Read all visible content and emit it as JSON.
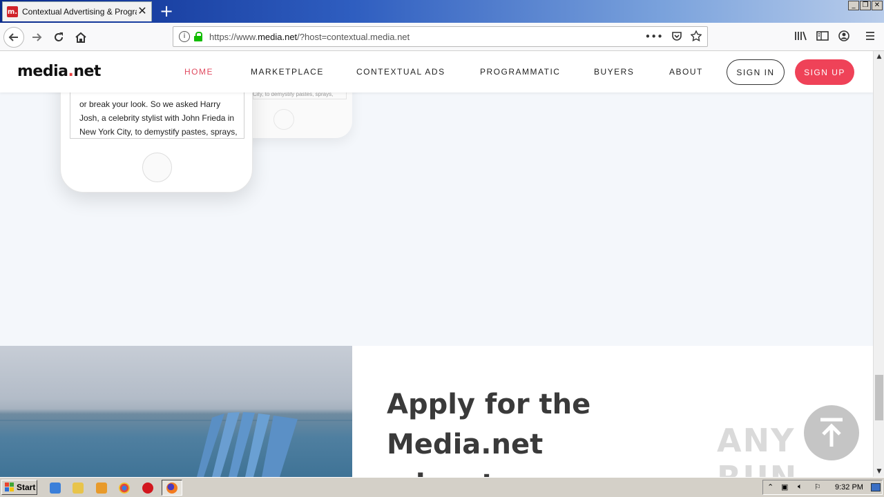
{
  "browser": {
    "tab_title": "Contextual Advertising & Programm",
    "tab_favicon": "m.",
    "new_tab_glyph": "+",
    "url_prefix": "https://www.",
    "url_domain": "media.net",
    "url_suffix": "/?host=contextual.media.net",
    "page_actions_glyph": "•••"
  },
  "site": {
    "logo_main": "media",
    "logo_dot": ".",
    "logo_tail": "net",
    "nav": {
      "home": "HOME",
      "marketplace": "MARKETPLACE",
      "contextual_ads": "CONTEXTUAL ADS",
      "programmatic": "PROGRAMMATIC",
      "buyers": "BUYERS",
      "about": "ABOUT"
    },
    "sign_in": "SIGN IN",
    "sign_up": "SIGN UP",
    "accent_color": "#ef4258"
  },
  "phone": {
    "lines": [
      " or break your look. So we asked Harry",
      "Josh, a celebrity stylist with John Frieda in",
      "New York City, to demystify pastes, sprays,"
    ],
    "back_phone_text": "City, to demystify pastes, sprays,"
  },
  "apply": {
    "title": "Apply for the Media.net advantage"
  },
  "watermark": "ANY RUN",
  "taskbar": {
    "start_label": "Start",
    "clock": "9:32 PM"
  }
}
